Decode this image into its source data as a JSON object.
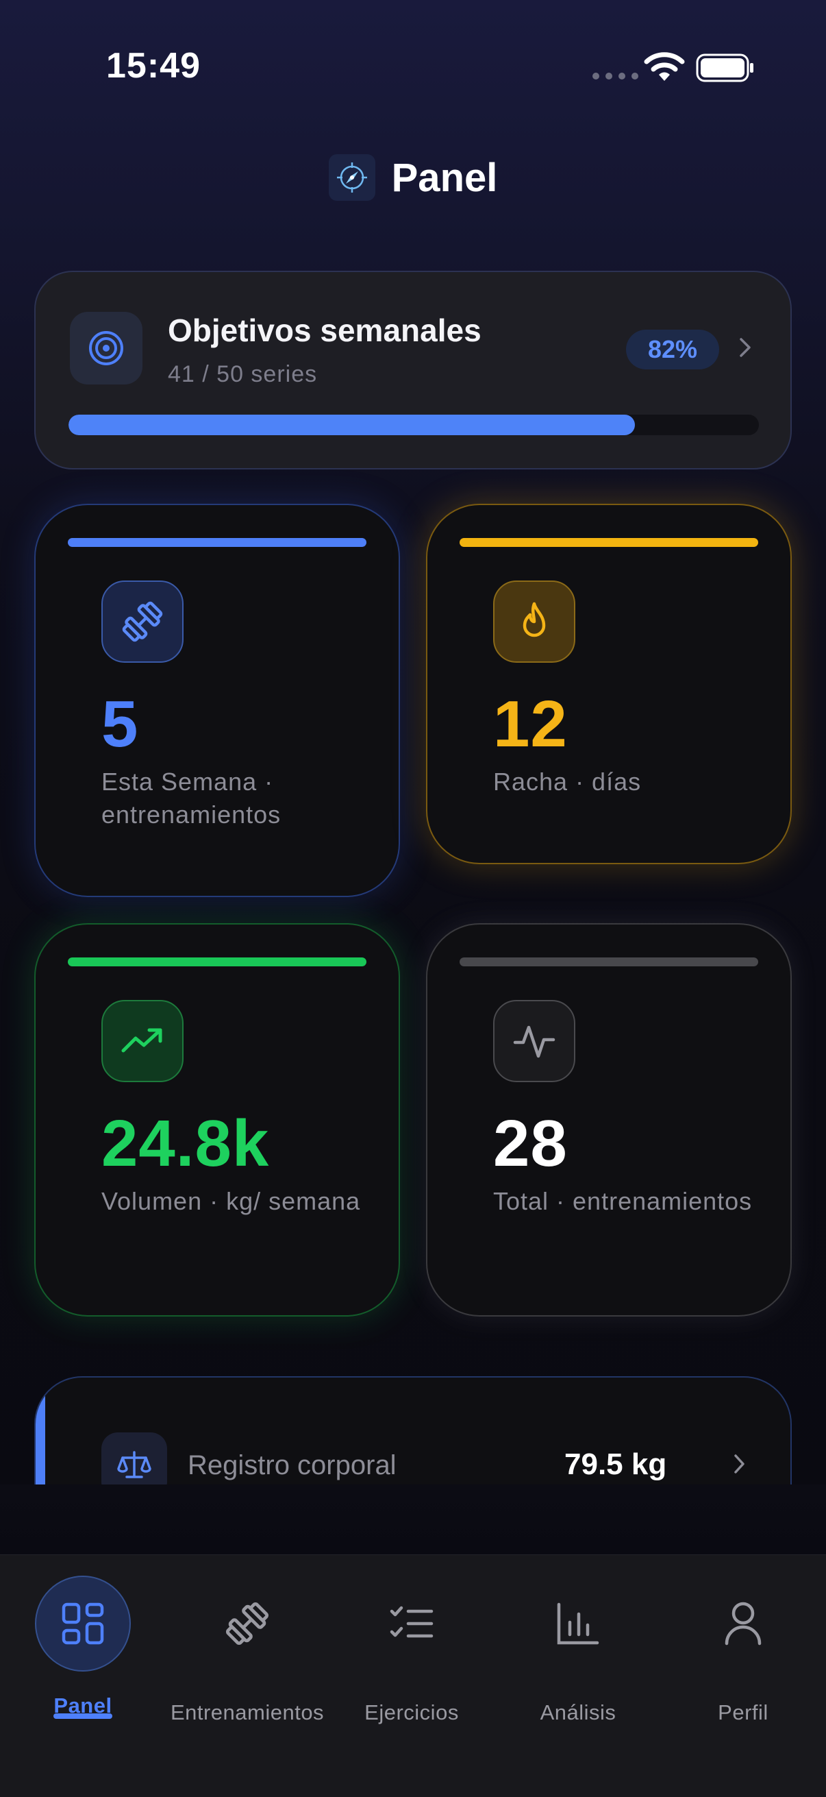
{
  "status_bar": {
    "time": "15:49"
  },
  "header": {
    "title": "Panel"
  },
  "weekly_goal": {
    "title": "Objetivos semanales",
    "subtitle": "41 / 50 series",
    "percent_label": "82%",
    "progress": 0.82
  },
  "stats": [
    {
      "value": "5",
      "label": "Esta Semana · entrenamientos",
      "color": "#4e80fa",
      "icon": "dumbbell-icon"
    },
    {
      "value": "12",
      "label": "Racha · días",
      "color": "#f5b417",
      "icon": "flame-icon"
    },
    {
      "value": "24.8k",
      "label": "Volumen · kg/ semana",
      "color": "#1ed15e",
      "icon": "trending-up-icon"
    },
    {
      "value": "28",
      "label": "Total · entrenamientos",
      "color": "#ffffff",
      "icon": "activity-icon"
    }
  ],
  "body_log": {
    "label": "Registro corporal",
    "value": "79.5 kg",
    "icon": "scale-icon"
  },
  "tabbar": {
    "items": [
      {
        "label": "Panel",
        "icon": "dashboard-icon",
        "active": true
      },
      {
        "label": "Entrenamientos",
        "icon": "dumbbell-icon",
        "active": false
      },
      {
        "label": "Ejercicios",
        "icon": "checklist-icon",
        "active": false
      },
      {
        "label": "Análisis",
        "icon": "bar-chart-icon",
        "active": false
      },
      {
        "label": "Perfil",
        "icon": "user-icon",
        "active": false
      }
    ]
  }
}
